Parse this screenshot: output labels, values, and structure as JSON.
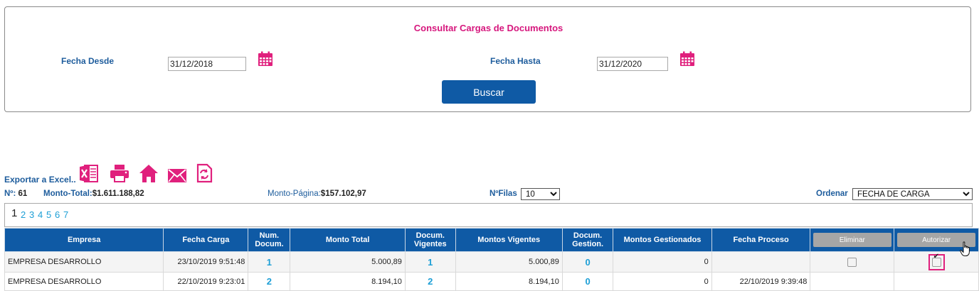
{
  "search": {
    "title": "Consultar Cargas de Documentos",
    "fecha_desde_label": "Fecha Desde",
    "fecha_desde_value": "31/12/2018",
    "fecha_hasta_label": "Fecha Hasta",
    "fecha_hasta_value": "31/12/2020",
    "buscar_label": "Buscar",
    "calendar_icon": "calendar-icon"
  },
  "toolbar": {
    "export_label": "Exportar a Excel..",
    "icons": [
      "excel-icon",
      "print-icon",
      "home-icon",
      "mail-icon",
      "refresh-icon"
    ],
    "accent_color": "#e0207d"
  },
  "stats": {
    "count_label": "Nº: ",
    "count_value": "61",
    "total_label": "Monto-Total:",
    "total_value": "$1.611.188,82",
    "page_label": "Monto-Página:",
    "page_value": "$157.102,97",
    "rows_label": "NºFilas",
    "rows_value": "10",
    "order_label": "Ordenar",
    "order_value": "FECHA DE CARGA"
  },
  "pager": {
    "current": "1",
    "pages": [
      "2",
      "3",
      "4",
      "5",
      "6",
      "7"
    ]
  },
  "table": {
    "header_color": "#0f5aa5",
    "columns": [
      "Empresa",
      "Fecha Carga",
      "Num. Docum.",
      "Monto Total",
      "Docum. Vigentes",
      "Montos Vigentes",
      "Docum. Gestion.",
      "Montos Gestionados",
      "Fecha Proceso"
    ],
    "eliminar_label": "Eliminar",
    "autorizar_label": "Autorizar",
    "rows": [
      {
        "empresa": "EMPRESA DESARROLLO",
        "fecha_carga": "23/10/2019 9:51:48",
        "num_docum": "1",
        "monto_total": "5.000,89",
        "docum_vigentes": "1",
        "montos_vigentes": "5.000,89",
        "docum_gestion": "0",
        "montos_gestionados": "0",
        "fecha_proceso": "",
        "eliminar_checked": false,
        "autorizar_checked": true
      },
      {
        "empresa": "EMPRESA DESARROLLO",
        "fecha_carga": "22/10/2019 9:23:01",
        "num_docum": "2",
        "monto_total": "8.194,10",
        "docum_vigentes": "2",
        "montos_vigentes": "8.194,10",
        "docum_gestion": "0",
        "montos_gestionados": "0",
        "fecha_proceso": "22/10/2019 9:39:48"
      }
    ]
  }
}
